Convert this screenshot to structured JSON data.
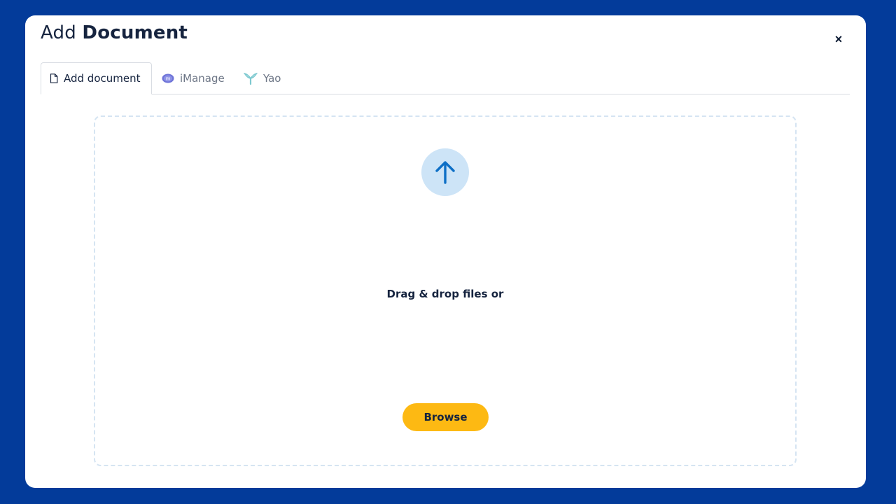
{
  "modal": {
    "title_prefix": "Add",
    "title_strong": "Document",
    "close_label": "×"
  },
  "tabs": [
    {
      "label": "Add document",
      "icon": "document-icon",
      "active": true
    },
    {
      "label": "iManage",
      "icon": "imanage-logo-icon",
      "active": false
    },
    {
      "label": "Yao",
      "icon": "yao-logo-icon",
      "active": false
    }
  ],
  "dropzone": {
    "icon": "upload-arrow-icon",
    "text": "Drag & drop files or",
    "browse_label": "Browse"
  },
  "colors": {
    "backdrop": "#033b9a",
    "accent_button": "#fdb913",
    "upload_circle": "#cde4f7",
    "upload_arrow": "#0d6fc6",
    "text_dark": "#16243f"
  }
}
